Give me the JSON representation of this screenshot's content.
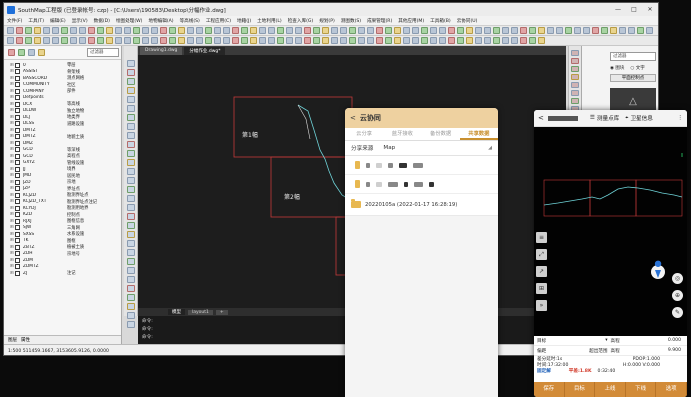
{
  "window": {
    "title": "SouthMap工程版 (已登录帐号: czp) - [C:\\Users\\190583\\Desktop\\分幅作业.dwg]",
    "controls": [
      "—",
      "□",
      "✕"
    ]
  },
  "menu": [
    "文件(F)",
    "工具(T)",
    "编辑(E)",
    "显示(V)",
    "数据(D)",
    "绘图处理(W)",
    "地物编辑(A)",
    "等高线(S)",
    "工程应用(C)",
    "地籍(J)",
    "土地利用(L)",
    "检查入库(G)",
    "规划(P)",
    "测图数(S)",
    "成果管理(R)",
    "其他应用(M)",
    "工具箱(B)",
    "云协同(U)"
  ],
  "layer_panel": {
    "filter_placeholder": "过滤器",
    "layers": [
      {
        "name": "0",
        "desc": "零层"
      },
      {
        "name": "ASSIST",
        "desc": "骨架线"
      },
      {
        "name": "BASSCORD",
        "desc": "测点网格"
      },
      {
        "name": "COMMUNITY",
        "desc": "社区"
      },
      {
        "name": "COMPANY",
        "desc": "部件"
      },
      {
        "name": "Defpoints",
        "desc": ""
      },
      {
        "name": "DCX",
        "desc": "等高线"
      },
      {
        "name": "DLDW",
        "desc": "独立地物"
      },
      {
        "name": "DLJ",
        "desc": "地类界"
      },
      {
        "name": "DLSS",
        "desc": "道路设施"
      },
      {
        "name": "DMTZ",
        "desc": ""
      },
      {
        "name": "DMTZ",
        "desc": "地貌土质"
      },
      {
        "name": "DMZ",
        "desc": ""
      },
      {
        "name": "GCD",
        "desc": "等深线"
      },
      {
        "name": "GCD",
        "desc": "高程点"
      },
      {
        "name": "GXYZ",
        "desc": "管线设施"
      },
      {
        "name": "JJ",
        "desc": "境界"
      },
      {
        "name": "JMD",
        "desc": "居民地"
      },
      {
        "name": "JZD",
        "desc": "宗地"
      },
      {
        "name": "JZP",
        "desc": "界址点"
      },
      {
        "name": "KCJZD",
        "desc": "勘测界址点"
      },
      {
        "name": "KCJZD_TXT",
        "desc": "勘测界址点注记"
      },
      {
        "name": "KCYDJ",
        "desc": "勘测用地界"
      },
      {
        "name": "KZD",
        "desc": "控制点"
      },
      {
        "name": "RJXJ",
        "desc": "图框信息"
      },
      {
        "name": "SJW",
        "desc": "三角网"
      },
      {
        "name": "SXSS",
        "desc": "水系设施"
      },
      {
        "name": "TK",
        "desc": "图框"
      },
      {
        "name": "ZBTZ",
        "desc": "植被土质"
      },
      {
        "name": "ZDH",
        "desc": "宗地号"
      },
      {
        "name": "ZDM",
        "desc": ""
      },
      {
        "name": "ZDMTZ",
        "desc": ""
      },
      {
        "name": "ZJ",
        "desc": "注记"
      }
    ],
    "foot_tabs": [
      "图层",
      "属性"
    ]
  },
  "doc_tabs": [
    "Drawing1.dwg",
    "分幅作业.dwg*"
  ],
  "canvas": {
    "sheet_labels": [
      "第1幅",
      "第2幅"
    ]
  },
  "model_tabs": [
    "模型",
    "layout1",
    "+"
  ],
  "command": {
    "lines": [
      "命令:",
      "命令:",
      "命令:"
    ]
  },
  "status": {
    "coords": "1:500  511459.1667, 3153605.9126, 0.0000"
  },
  "right_panel": {
    "filter_placeholder": "过滤器",
    "radio_a": "图块",
    "radio_b": "文字",
    "subheader": "平面控制点"
  },
  "cloud_app": {
    "title": "云协同",
    "back": "<",
    "tabs": [
      "云分享",
      "蓝牙接收",
      "备份数据",
      "共享数据"
    ],
    "source_label": "分享来源",
    "source_value": "Map",
    "folder_entry": "20220105a (2022-01-17 16:28:19)"
  },
  "survey_app": {
    "back": "<",
    "point_lib": "测量点库",
    "satellite": "卫星信息",
    "more": "⋮",
    "field_target": "目标",
    "field_height": "高程",
    "field_height_val": "0.000",
    "field_offset": "偏距",
    "field_offset_val": "超出范围",
    "field_elev": "高程",
    "field_elev_val": "9.900",
    "stat_solution": "差分延时:1s",
    "stat_time": "时间:17:32:00",
    "stat_fixed": "固定解",
    "stat_pdop": "PDOP:1.000",
    "stat_hv": "H:0.000  V:0.000",
    "stat_acc": "平差:1.8K",
    "stat_clock": "0:32:40",
    "buttons": [
      "保存",
      "目标",
      "上线",
      "下线",
      "选项"
    ]
  }
}
